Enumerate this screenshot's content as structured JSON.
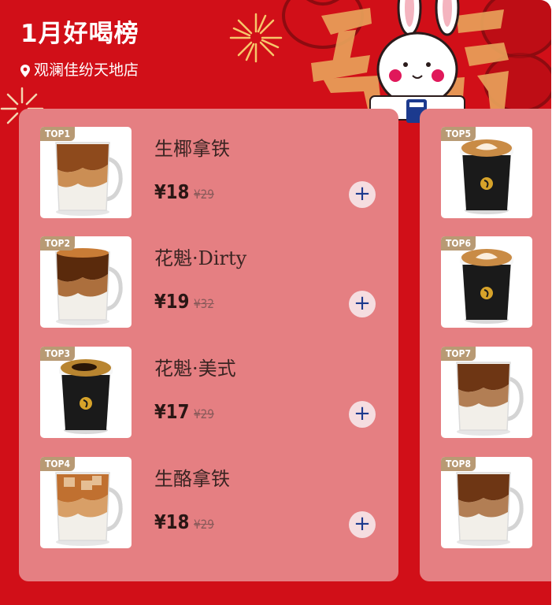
{
  "header": {
    "title": "1月好喝榜",
    "store": "观澜佳纷天地店",
    "store_icon": "location-pin-icon"
  },
  "colors": {
    "background": "#d10f18",
    "panel": "#e57f82",
    "rank_badge": "#b89a74",
    "add_button": "#f5dde0",
    "add_icon": "#1c3a8e"
  },
  "currency": "¥",
  "items": [
    {
      "rank": "TOP1",
      "name": "生椰拿铁",
      "price": "18",
      "original_price": "29",
      "style": "glass-caramel"
    },
    {
      "rank": "TOP2",
      "name": "花魁·Dirty",
      "price": "19",
      "original_price": "32",
      "style": "glass-dirty"
    },
    {
      "rank": "TOP3",
      "name": "花魁·美式",
      "price": "17",
      "original_price": "29",
      "style": "cup-black"
    },
    {
      "rank": "TOP4",
      "name": "生酪拿铁",
      "price": "18",
      "original_price": "29",
      "style": "glass-ice"
    },
    {
      "rank": "TOP5",
      "style": "cup-latte-art"
    },
    {
      "rank": "TOP6",
      "style": "cup-latte-art"
    },
    {
      "rank": "TOP7",
      "style": "glass-latte"
    },
    {
      "rank": "TOP8",
      "style": "glass-latte"
    }
  ],
  "add_label": "+"
}
